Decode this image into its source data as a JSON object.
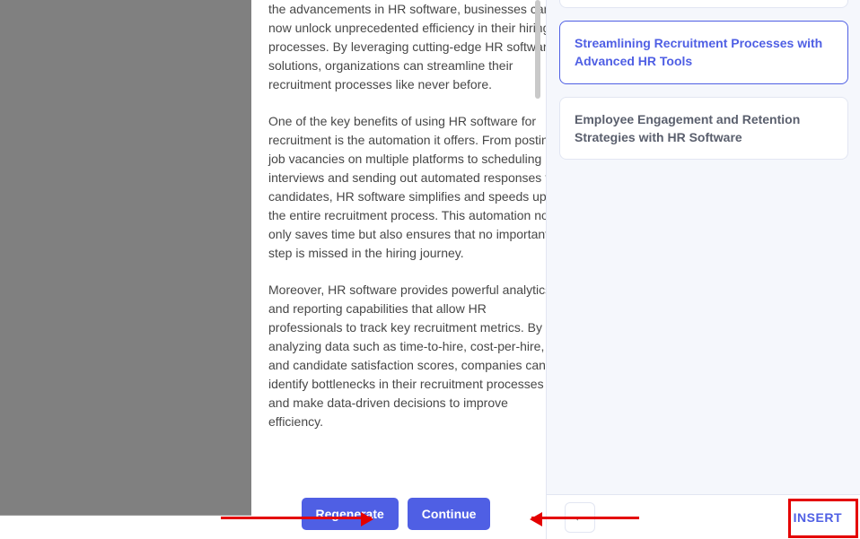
{
  "content": {
    "para1": "the advancements in HR software, businesses can now unlock unprecedented efficiency in their hiring processes. By leveraging cutting-edge HR software solutions, organizations can streamline their recruitment processes like never before.",
    "para2": " One of the key benefits of using HR software for recruitment is the automation it offers. From posting job vacancies on multiple platforms to scheduling interviews and sending out automated responses to candidates, HR software simplifies and speeds up the entire recruitment process. This automation not only saves time but also ensures that no important step is missed in the hiring journey.",
    "para3": " Moreover, HR software provides powerful analytics and reporting capabilities that allow HR professionals to track key recruitment metrics. By analyzing data such as time-to-hire, cost-per-hire, and candidate satisfaction scores, companies can identify bottlenecks in their recruitment processes and make data-driven decisions to improve efficiency."
  },
  "actions": {
    "regenerate": "Regenerate",
    "continue": "Continue"
  },
  "suggestions": {
    "item_partial_top": "",
    "item_selected": "Streamlining Recruitment Processes with Advanced HR Tools",
    "item_other": "Employee Engagement and Retention Strategies with HR Software"
  },
  "footer": {
    "back_glyph": "←",
    "insert": "INSERT"
  }
}
